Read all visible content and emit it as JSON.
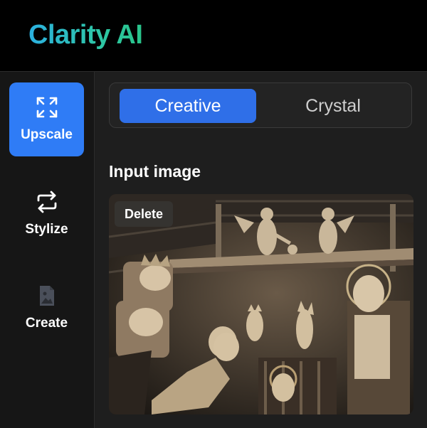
{
  "app": {
    "title": "Clarity AI"
  },
  "sidebar": {
    "items": [
      {
        "label": "Upscale",
        "icon": "expand-icon",
        "active": true
      },
      {
        "label": "Stylize",
        "icon": "swap-arrows-icon",
        "active": false
      },
      {
        "label": "Create",
        "icon": "image-icon",
        "active": false
      }
    ]
  },
  "mode_switch": {
    "options": [
      "Creative",
      "Crystal"
    ],
    "selected": "Creative"
  },
  "input": {
    "title": "Input image",
    "delete_label": "Delete"
  },
  "colors": {
    "accent": "#2f7cf6",
    "brand_start": "#2bb0e0",
    "brand_end": "#29c48a",
    "background": "#1e1e1e"
  }
}
